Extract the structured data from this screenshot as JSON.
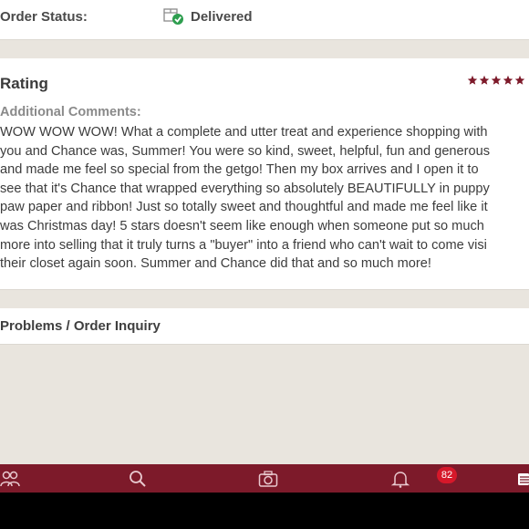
{
  "order_status": {
    "label": "Order Status:",
    "value": "Delivered",
    "icon": "delivered-box-check-icon",
    "check_color": "#2e9e4f"
  },
  "rating": {
    "title": "Rating",
    "stars": 5,
    "star_color": "#7d1a2a",
    "comments_heading": "Additional Comments:",
    "comment_lines": [
      "WOW WOW WOW! What a complete and utter treat and experience shopping with",
      "you and Chance was, Summer! You were so kind, sweet, helpful, fun and generous",
      "and made me feel so special from the getgo! Then my box arrives and I open it to",
      "see that it's Chance that wrapped everything so absolutely BEAUTIFULLY in puppy",
      "paw paper and ribbon! Just so totally sweet and thoughtful and made me feel like it",
      "was Christmas day! 5 stars doesn't seem like enough when someone put so much",
      "more into selling that it truly turns a \"buyer\" into a friend who can't wait to come visi",
      "their closet again soon. Summer and Chance did that and so much more!"
    ]
  },
  "problems": {
    "label": "Problems / Order Inquiry"
  },
  "tab_bar": {
    "background": "#7d1a2a",
    "tabs": [
      {
        "icon": "community-icon"
      },
      {
        "icon": "search-icon"
      },
      {
        "icon": "camera-icon"
      },
      {
        "icon": "bell-icon",
        "badge": "82"
      },
      {
        "icon": "menu-icon"
      }
    ]
  }
}
